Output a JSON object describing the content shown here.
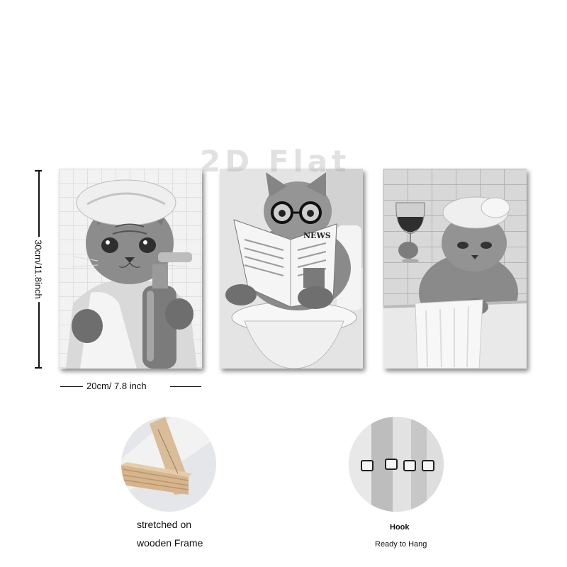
{
  "watermark": "2D Flat",
  "dimensions": {
    "height_label": "30cm/11.8inch",
    "width_label": "20cm/ 7.8 inch"
  },
  "panels": [
    {
      "subject": "cat-with-towel-and-lotion-bottle"
    },
    {
      "subject": "cat-reading-newspaper-on-toilet",
      "newspaper_text": "NEWS"
    },
    {
      "subject": "cat-in-bathtub-with-wine-glass"
    }
  ],
  "features": [
    {
      "lines": [
        "stretched on",
        "wooden Frame"
      ]
    },
    {
      "lines": [
        "Hook",
        "Ready to Hang"
      ]
    }
  ],
  "colors": {
    "background": "#ffffff",
    "wood": "#d8b893",
    "gray_dark": "#3a3a3a",
    "gray_light": "#e6e6e6"
  }
}
